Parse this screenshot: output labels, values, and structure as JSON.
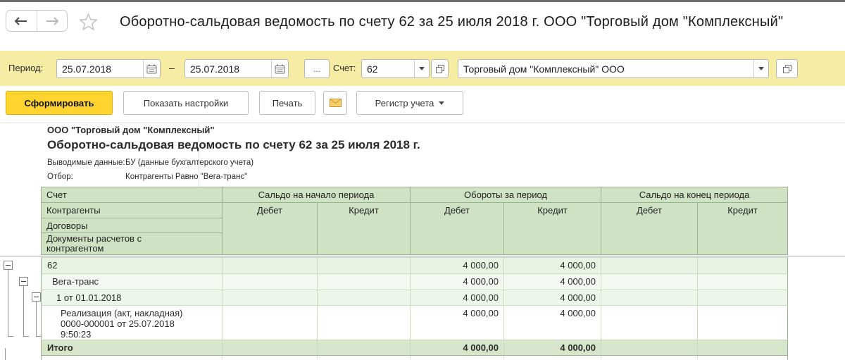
{
  "window": {
    "title": "Оборотно-сальдовая ведомость по счету 62 за 25 июля 2018 г. ООО \"Торговый дом \"Комплексный\""
  },
  "filter_panel": {
    "period_label": "Период:",
    "period_from": "25.07.2018",
    "period_to": "25.07.2018",
    "dash": "–",
    "more_button": "...",
    "account_label": "Счет:",
    "account_value": "62",
    "organization_value": "Торговый дом \"Комплексный\" ООО"
  },
  "toolbar": {
    "generate_label": "Сформировать",
    "show_settings_label": "Показать настройки",
    "print_label": "Печать",
    "register_label": "Регистр учета"
  },
  "report": {
    "organization": "ООО \"Торговый дом \"Комплексный\"",
    "title": "Оборотно-сальдовая ведомость по счету 62 за 25 июля 2018 г.",
    "meta": [
      {
        "label": "Выводимые данные:",
        "value": "БУ (данные бухгалтерского учета)"
      },
      {
        "label": "Отбор:",
        "value": "Контрагенты Равно \"Вега-транс\""
      }
    ],
    "table": {
      "row_dimension_labels": [
        "Счет",
        "Контрагенты",
        "Договоры",
        "Документы расчетов с\nконтрагентом"
      ],
      "column_groups": [
        "Сальдо на начало периода",
        "Обороты за период",
        "Сальдо на конец периода"
      ],
      "debit_label": "Дебет",
      "credit_label": "Кредит",
      "rows": [
        {
          "label": "62",
          "values": [
            "",
            "",
            "4 000,00",
            "4 000,00",
            "",
            ""
          ]
        },
        {
          "label": "Вега-транс",
          "values": [
            "",
            "",
            "4 000,00",
            "4 000,00",
            "",
            ""
          ]
        },
        {
          "label": "1 от 01.01.2018",
          "values": [
            "",
            "",
            "4 000,00",
            "4 000,00",
            "",
            ""
          ]
        },
        {
          "label": "Реализация (акт, накладная)\n0000-000001 от 25.07.2018\n9:50:23",
          "values": [
            "",
            "",
            "4 000,00",
            "4 000,00",
            "",
            ""
          ]
        },
        {
          "label": "Итого",
          "values": [
            "",
            "",
            "4 000,00",
            "4 000,00",
            "",
            ""
          ]
        }
      ]
    }
  }
}
